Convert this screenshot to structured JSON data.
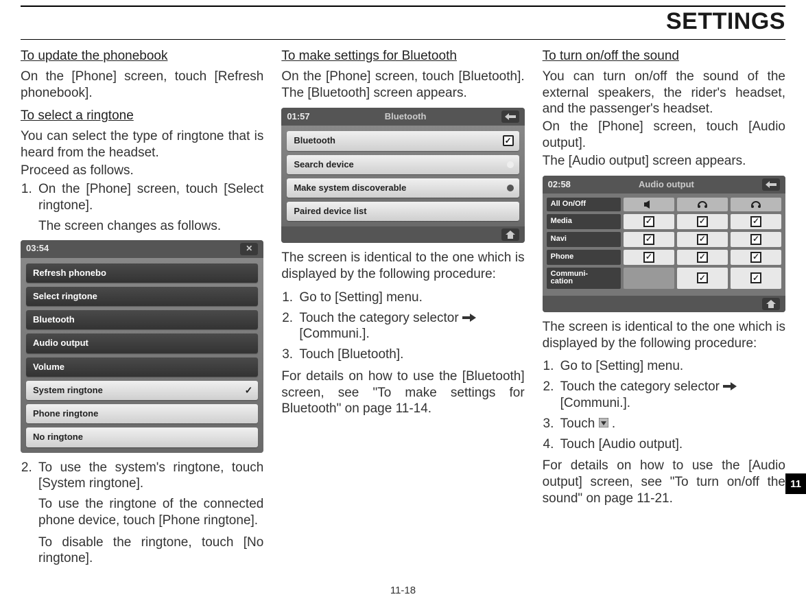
{
  "header": {
    "title": "SETTINGS"
  },
  "footer": {
    "page": "11-18"
  },
  "sidetab": {
    "num": "11"
  },
  "col1": {
    "h1": "To update the phonebook",
    "p1": "On the [Phone] screen, touch [Refresh phonebook].",
    "h2": "To select a ringtone",
    "p2a": "You can select the type of ringtone that is heard from the headset.",
    "p2b": "Proceed as follows.",
    "li1a": "On the [Phone] screen, touch [Select ringtone].",
    "li1b": "The screen changes as follows.",
    "li2a": "To use the system's ringtone, touch [System ringtone].",
    "li2b": "To use the ringtone of the connected phone device, touch [Phone ringtone].",
    "li2c": "To disable the ringtone, touch [No ringtone].",
    "shot": {
      "time": "03:54",
      "left": [
        "Refresh phonebo",
        "Select ringtone",
        "Bluetooth",
        "Audio output",
        "Volume"
      ],
      "right": [
        "System ringtone",
        "Phone ringtone",
        "No ringtone"
      ]
    }
  },
  "col2": {
    "h1": "To make settings for Bluetooth",
    "p1": "On the [Phone] screen, touch [Bluetooth]. The [Bluetooth] screen appears.",
    "shot": {
      "time": "01:57",
      "title": "Bluetooth",
      "rows": [
        "Bluetooth",
        "Search device",
        "Make system discoverable",
        "Paired device list"
      ]
    },
    "p2": "The screen is identical to the one which is displayed by the following procedure:",
    "li1": "Go to [Setting] menu.",
    "li2": "Touch the category selector ",
    "li2b": "[Communi.].",
    "li3": "Touch [Bluetooth].",
    "p3": "For details on how to use the [Bluetooth] screen, see \"To make settings for Bluetooth\" on page 11-14."
  },
  "col3": {
    "h1": "To turn on/off the sound",
    "p1": "You can turn on/off the sound of the external speakers, the rider's headset, and the passenger's headset.",
    "p1b": "On the [Phone] screen, touch [Audio output].",
    "p1c": "The [Audio output] screen appears.",
    "shot": {
      "time": "02:58",
      "title": "Audio output",
      "rows": [
        "All On/Off",
        "Media",
        "Navi",
        "Phone",
        "Communi-\ncation"
      ]
    },
    "p2": "The screen is identical to the one which is displayed by the following procedure:",
    "li1": "Go to [Setting] menu.",
    "li2": "Touch the category selector ",
    "li2b": "[Communi.].",
    "li3a": "Touch ",
    "li3b": " .",
    "li4": "Touch [Audio output].",
    "p3": "For details on how to use the [Audio output] screen, see \"To turn on/off the sound\" on page 11-21."
  }
}
